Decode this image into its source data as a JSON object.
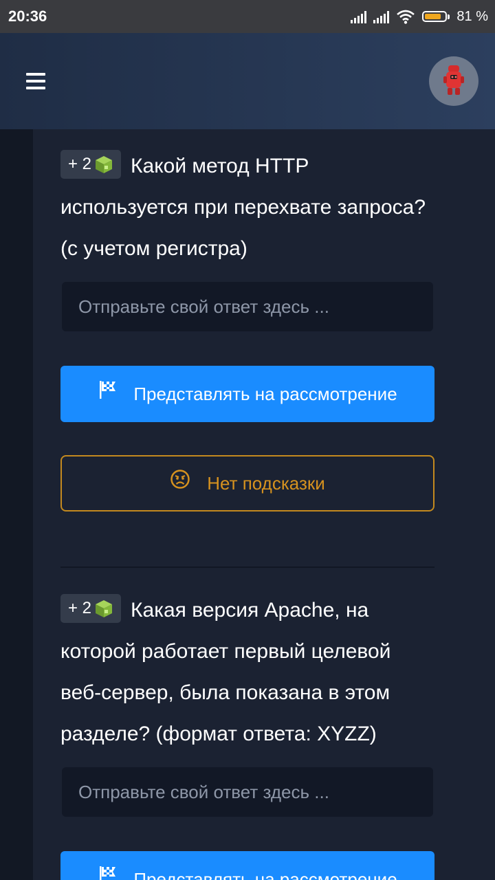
{
  "status_bar": {
    "time": "20:36",
    "battery_pct": "81 %",
    "battery_level": 0.81
  },
  "header": {
    "menu_icon": "hamburger-menu-icon",
    "avatar_icon": "robot-avatar-icon"
  },
  "questions": [
    {
      "points": "+ 2",
      "text": "Какой метод HTTP используется при перехвате запроса? (с учетом регистра)",
      "input_placeholder": "Отправьте свой ответ здесь ...",
      "submit_label": "Представлять на рассмотрение",
      "hint_label": "Нет подсказки"
    },
    {
      "points": "+ 2",
      "text": "Какая версия Apache, на которой работает первый целевой веб-сервер, была показана в этом разделе? (формат ответа: XYZZ)",
      "input_placeholder": "Отправьте свой ответ здесь ...",
      "submit_label": "Представлять на рассмотрение"
    }
  ],
  "colors": {
    "accent": "#1a8cff",
    "hint": "#c48a1e",
    "background": "#1b2232",
    "header": "#2c3f5e"
  }
}
